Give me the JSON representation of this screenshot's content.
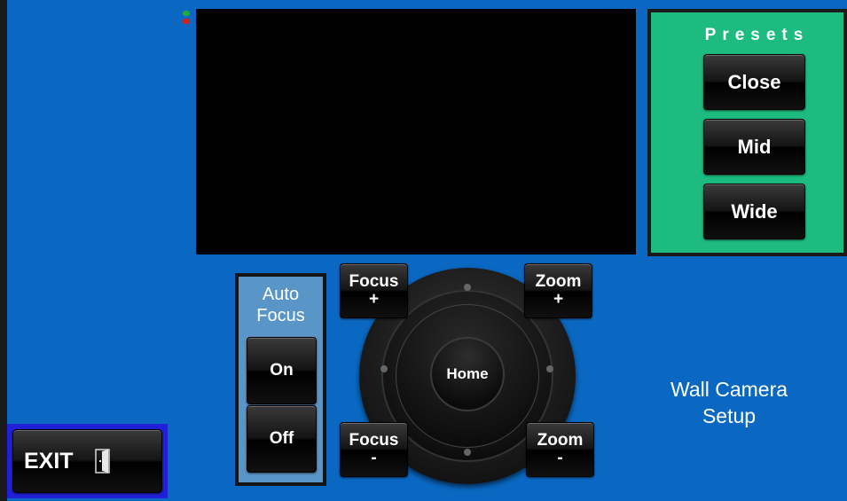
{
  "presets": {
    "title": "Presets",
    "buttons": [
      "Close",
      "Mid",
      "Wide"
    ]
  },
  "auto_focus": {
    "title_line1": "Auto",
    "title_line2": "Focus",
    "on_label": "On",
    "off_label": "Off"
  },
  "dpad": {
    "home_label": "Home",
    "focus_plus": {
      "line1": "Focus",
      "line2": "+"
    },
    "zoom_plus": {
      "line1": "Zoom",
      "line2": "+"
    },
    "focus_minus": {
      "line1": "Focus",
      "line2": "-"
    },
    "zoom_minus": {
      "line1": "Zoom",
      "line2": "-"
    }
  },
  "exit": {
    "label": "EXIT",
    "icon": "door-exit-icon"
  },
  "screen": {
    "title_line1": "Wall Camera",
    "title_line2": "Setup"
  },
  "status_indicators": [
    {
      "color": "#1fae3c"
    },
    {
      "color": "#d81e1e"
    }
  ],
  "colors": {
    "background": "#0a68c2",
    "presets_panel": "#1dbb80",
    "auto_focus_panel": "#5a95c8",
    "exit_frame": "#2020d8"
  }
}
